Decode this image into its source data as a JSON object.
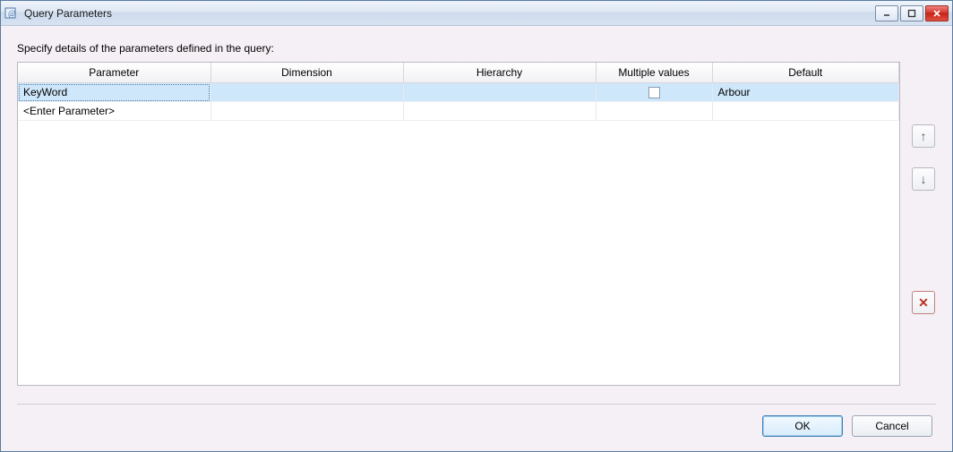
{
  "window": {
    "title": "Query Parameters"
  },
  "instruction": "Specify details of the parameters defined in the query:",
  "columns": {
    "parameter": "Parameter",
    "dimension": "Dimension",
    "hierarchy": "Hierarchy",
    "multiple": "Multiple values",
    "default": "Default"
  },
  "rows": [
    {
      "parameter": "KeyWord",
      "dimension": "",
      "hierarchy": "",
      "multiple": false,
      "default": "Arbour",
      "selected": true
    },
    {
      "parameter": "<Enter Parameter>",
      "dimension": "",
      "hierarchy": "",
      "multiple": null,
      "default": "",
      "selected": false
    }
  ],
  "buttons": {
    "ok": "OK",
    "cancel": "Cancel"
  },
  "icons": {
    "up": "↑",
    "down": "↓",
    "delete": "✕",
    "minimize": "–",
    "maximize": "□",
    "close": "✕"
  }
}
